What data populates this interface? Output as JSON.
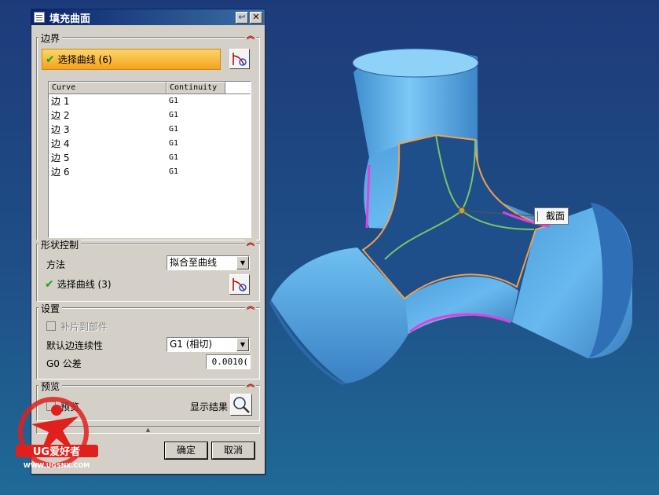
{
  "dialog": {
    "title": "填充曲面",
    "boundary": {
      "title": "边界",
      "select_label": "选择曲线 (6)",
      "columns": [
        "Curve",
        "Continuity"
      ],
      "rows": [
        {
          "curve": "边 1",
          "continuity": "G1"
        },
        {
          "curve": "边 2",
          "continuity": "G1"
        },
        {
          "curve": "边 3",
          "continuity": "G1"
        },
        {
          "curve": "边 4",
          "continuity": "G1"
        },
        {
          "curve": "边 5",
          "continuity": "G1"
        },
        {
          "curve": "边 6",
          "continuity": "G1"
        }
      ]
    },
    "shape": {
      "title": "形状控制",
      "method_label": "方法",
      "method_value": "拟合至曲线",
      "select_label": "选择曲线 (3)"
    },
    "settings": {
      "title": "设置",
      "patch_label": "补片到部件",
      "continuity_label": "默认边连续性",
      "continuity_value": "G1 (相切)",
      "tolerance_label": "G0 公差",
      "tolerance_value": "0.0010("
    },
    "preview": {
      "title": "预览",
      "preview_label": "预览",
      "show_result_label": "显示结果"
    },
    "ok": "确定",
    "cancel": "取消"
  },
  "tooltip": "截面",
  "watermark": {
    "brand": "UG爱好者",
    "url": "WWW.UGSNX.COM"
  },
  "colors": {
    "surface": "#5bb8f2",
    "boundary": "#f0a050",
    "guide_curve": "#7cc36a",
    "edge_magenta": "#e040e0"
  }
}
